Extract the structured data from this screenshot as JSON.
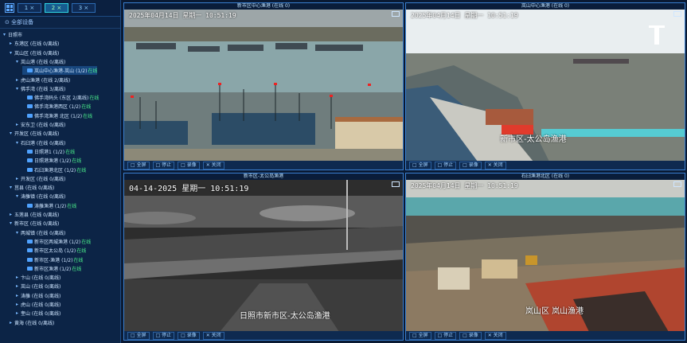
{
  "toolbar": {
    "layouts": [
      "1 ×",
      "2 ×",
      "3 ×"
    ],
    "active_layout": 1
  },
  "tree": {
    "header": "⊙ 全部设备",
    "items": [
      {
        "t": "▾",
        "label": "日照市",
        "cam": false,
        "st": "",
        "d": 0
      },
      {
        "t": "▸",
        "label": "东港区 (在线 0/离线)",
        "cam": false,
        "st": "",
        "d": 1
      },
      {
        "t": "▾",
        "label": "岚山区 (在线 0/离线)",
        "cam": false,
        "st": "",
        "d": 1
      },
      {
        "t": "▾",
        "label": "岚山港 (在线 0/离线)",
        "cam": false,
        "st": "",
        "d": 2
      },
      {
        "t": "",
        "label": "岚山中心渔港-岚山 (1/2)",
        "cam": true,
        "st": "在线",
        "d": 3
      },
      {
        "t": "▸",
        "label": "虎山渔港 (在线 2/离线)",
        "cam": false,
        "st": "",
        "d": 2
      },
      {
        "t": "▾",
        "label": "佛手湾 (在线 3/离线)",
        "cam": false,
        "st": "",
        "d": 2
      },
      {
        "t": "",
        "label": "佛手湾码头 (东区 2/离线)",
        "cam": true,
        "st": "在线",
        "d": 3
      },
      {
        "t": "",
        "label": "佛手湾渔港西区 (1/2)",
        "cam": true,
        "st": "在线",
        "d": 3
      },
      {
        "t": "",
        "label": "佛手湾渔港 北区 (1/2)",
        "cam": true,
        "st": "在线",
        "d": 3
      },
      {
        "t": "▸",
        "label": "安东卫 (在线 0/离线)",
        "cam": false,
        "st": "",
        "d": 2
      },
      {
        "t": "▾",
        "label": "开发区 (在线 0/离线)",
        "cam": false,
        "st": "",
        "d": 1
      },
      {
        "t": "▾",
        "label": "石臼港 (在线 0/离线)",
        "cam": false,
        "st": "",
        "d": 2
      },
      {
        "t": "",
        "label": "日照港1 (1/2)",
        "cam": true,
        "st": "在线",
        "d": 3
      },
      {
        "t": "",
        "label": "日照港渔港 (1/2)",
        "cam": true,
        "st": "在线",
        "d": 3
      },
      {
        "t": "",
        "label": "石臼渔港北区 (1/2)",
        "cam": true,
        "st": "在线",
        "d": 3
      },
      {
        "t": "▸",
        "label": "开发区 (在线 0/离线)",
        "cam": false,
        "st": "",
        "d": 2
      },
      {
        "t": "▾",
        "label": "莒县 (在线 0/离线)",
        "cam": false,
        "st": "",
        "d": 1
      },
      {
        "t": "▾",
        "label": "涛雒镇 (在线 0/离线)",
        "cam": false,
        "st": "",
        "d": 2
      },
      {
        "t": "",
        "label": "涛雒渔港 (1/2)",
        "cam": true,
        "st": "在线",
        "d": 3
      },
      {
        "t": "▸",
        "label": "五莲县 (在线 0/离线)",
        "cam": false,
        "st": "",
        "d": 1
      },
      {
        "t": "▾",
        "label": "新市区 (在线 0/离线)",
        "cam": false,
        "st": "",
        "d": 1
      },
      {
        "t": "▾",
        "label": "两城镇 (在线 0/离线)",
        "cam": false,
        "st": "",
        "d": 2
      },
      {
        "t": "",
        "label": "新市区两城渔港 (1/2)",
        "cam": true,
        "st": "在线",
        "d": 3
      },
      {
        "t": "",
        "label": "新市区太公岛 (1/2)",
        "cam": true,
        "st": "在线",
        "d": 3
      },
      {
        "t": "",
        "label": "新市区-渔港 (1/2)",
        "cam": true,
        "st": "在线",
        "d": 3
      },
      {
        "t": "",
        "label": "新市区渔港 (1/2)",
        "cam": true,
        "st": "在线",
        "d": 3
      },
      {
        "t": "▸",
        "label": "卞山 (在线 0/离线)",
        "cam": false,
        "st": "",
        "d": 2
      },
      {
        "t": "▸",
        "label": "岚山 (在线 0/离线)",
        "cam": false,
        "st": "",
        "d": 2
      },
      {
        "t": "▸",
        "label": "涛雒 (在线 0/离线)",
        "cam": false,
        "st": "",
        "d": 2
      },
      {
        "t": "▸",
        "label": "虎山 (在线 0/离线)",
        "cam": false,
        "st": "",
        "d": 2
      },
      {
        "t": "▸",
        "label": "奎山 (在线 0/离线)",
        "cam": false,
        "st": "",
        "d": 2
      },
      {
        "t": "▸",
        "label": "黄海 (在线 0/离线)",
        "cam": false,
        "st": "",
        "d": 1
      }
    ]
  },
  "videos": [
    {
      "title": "新市区中心渔港 (在线 0)",
      "osd": "2025年04月14日 星期一 10:51:19",
      "loc": "",
      "controls": [
        "□ 全屏",
        "□ 停止",
        "□ 录像",
        "✕ 关闭"
      ]
    },
    {
      "title": "岚山中心渔港 (在线 0)",
      "osd": "2025年04月14日 星期一 10:51:19",
      "loc": "新市区-太公岛渔港",
      "controls": [
        "□ 全屏",
        "□ 停止",
        "□ 录像",
        "✕ 关闭"
      ]
    },
    {
      "title": "新市区-太公岛渔港",
      "osd": "04-14-2025 星期一 10:51:19",
      "loc": "日照市新市区-太公岛渔港",
      "controls": [
        "□ 全屏",
        "□ 停止",
        "□ 录像",
        "✕ 关闭"
      ]
    },
    {
      "title": "石臼渔港北区 (在线 0)",
      "osd": "2025年04月14日 星期一 10:51:19",
      "loc": "岚山区 岚山渔港",
      "controls": [
        "□ 全屏",
        "□ 停止",
        "□ 录像",
        "✕ 关闭"
      ]
    }
  ],
  "colors": {
    "accent": "#2fd6e4",
    "online": "#4bf08b",
    "panel": "#0c2446"
  }
}
